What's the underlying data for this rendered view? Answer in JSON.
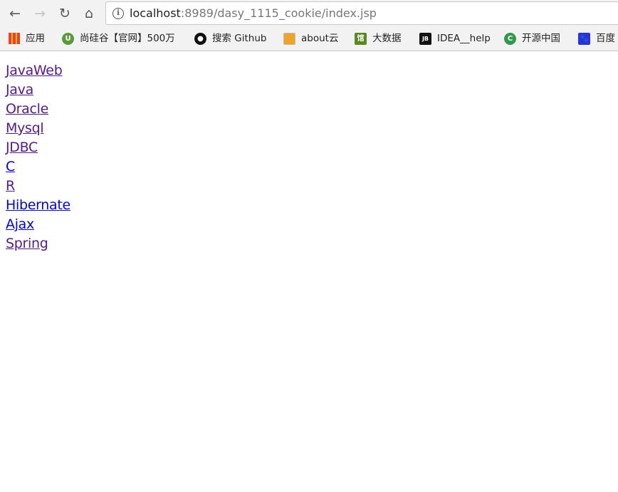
{
  "browser": {
    "url_host": "localhost",
    "url_rest": ":8989/dasy_1115_cookie/index.jsp",
    "icons": {
      "back": "arrow-left-icon",
      "forward": "arrow-right-icon",
      "reload": "reload-icon",
      "home": "home-icon",
      "info": "info-icon"
    }
  },
  "bookmarks": [
    {
      "label": "应用",
      "icon": "apps-grid-icon"
    },
    {
      "label": "尚硅谷【官网】500万",
      "icon": "atguigu-icon"
    },
    {
      "label": "搜索 Github",
      "icon": "github-icon"
    },
    {
      "label": "about云",
      "icon": "about-cloud-icon"
    },
    {
      "label": "大数据",
      "icon": "guan-icon"
    },
    {
      "label": "IDEA__help",
      "icon": "jetbrains-icon"
    },
    {
      "label": "开源中国",
      "icon": "oschina-icon"
    },
    {
      "label": "百度",
      "icon": "baidu-icon"
    }
  ],
  "links": [
    {
      "label": "JavaWeb",
      "visited": true
    },
    {
      "label": "Java",
      "visited": true
    },
    {
      "label": "Oracle",
      "visited": true
    },
    {
      "label": "Mysql",
      "visited": true
    },
    {
      "label": "JDBC",
      "visited": true
    },
    {
      "label": "C",
      "visited": false
    },
    {
      "label": "R",
      "visited": true
    },
    {
      "label": "Hibernate",
      "visited": false
    },
    {
      "label": "Ajax",
      "visited": false
    },
    {
      "label": "Spring",
      "visited": true
    }
  ],
  "colors": {
    "link": "#0000ee",
    "visited": "#551a8b"
  }
}
